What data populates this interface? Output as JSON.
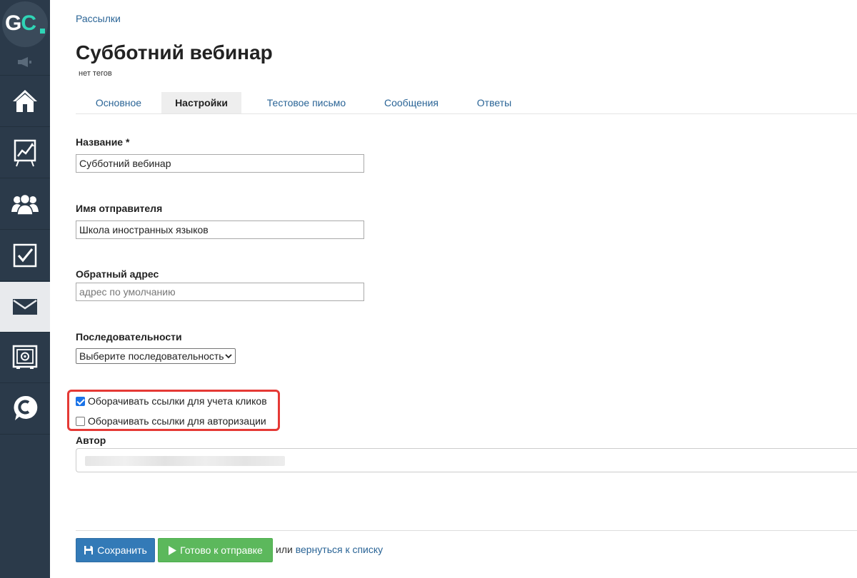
{
  "sidebar": {
    "logo": "GC",
    "nav": [
      {
        "icon": "home-icon"
      },
      {
        "icon": "chart-icon"
      },
      {
        "icon": "users-icon"
      },
      {
        "icon": "tasks-icon"
      },
      {
        "icon": "mail-icon",
        "active": true
      },
      {
        "icon": "safe-icon"
      },
      {
        "icon": "chat-icon"
      }
    ]
  },
  "breadcrumb": "Рассылки",
  "page": {
    "title": "Субботний вебинар",
    "tags": "нет тегов"
  },
  "tabs": [
    {
      "label": "Основное"
    },
    {
      "label": "Настройки",
      "active": true
    },
    {
      "label": "Тестовое письмо"
    },
    {
      "label": "Сообщения"
    },
    {
      "label": "Ответы"
    }
  ],
  "form": {
    "name": {
      "label": "Название *",
      "value": "Субботний вебинар"
    },
    "sender": {
      "label": "Имя отправителя",
      "value": "Школа иностранных языков"
    },
    "reply": {
      "label": "Обратный адрес",
      "value": "",
      "placeholder": "адрес по умолчанию"
    },
    "sequences": {
      "label": "Последовательности",
      "selected": "Выберите последовательность"
    },
    "wrap_clicks": {
      "label": "Оборачивать ссылки для учета кликов",
      "checked": true
    },
    "wrap_auth": {
      "label": "Оборачивать ссылки для авторизации",
      "checked": false
    },
    "author": {
      "label": "Автор"
    }
  },
  "footer": {
    "save_label": "Сохранить",
    "ready_label": "Готово к отправке",
    "or_text": "или",
    "back_link": "вернуться к списку"
  },
  "colors": {
    "sidebar": "#2b3a4a",
    "accent": "#2fd5b6",
    "link": "#2a6496",
    "save": "#337ab7",
    "ready": "#5cb85c",
    "highlight": "#e53935"
  }
}
